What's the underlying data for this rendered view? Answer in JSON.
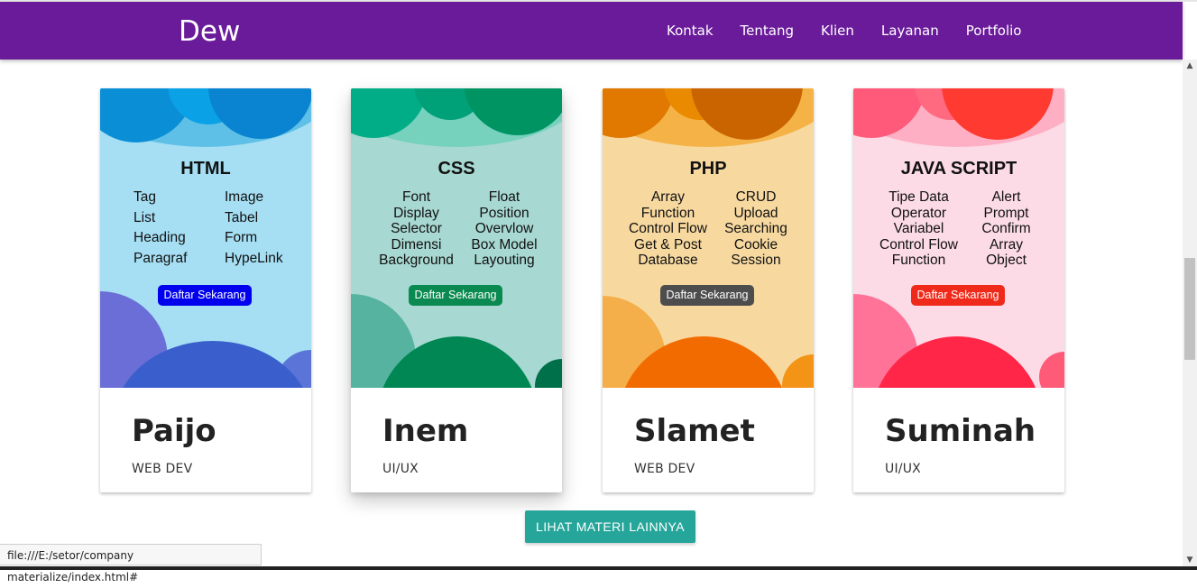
{
  "navbar": {
    "brand": "Dew",
    "links": [
      "Kontak",
      "Tentang",
      "Klien",
      "Layanan",
      "Portfolio"
    ],
    "color": "#6a1b9a"
  },
  "cards": [
    {
      "title": "HTML",
      "left_items": [
        "Tag",
        "List",
        "Heading",
        "Paragraf"
      ],
      "right_items": [
        "Image",
        "Tabel",
        "Form",
        "HypeLink"
      ],
      "button": "Daftar Sekarang",
      "name": "Paijo",
      "role": "WEB DEV",
      "colors": {
        "bg": "#a6dff4",
        "accent": "#0288d1",
        "button": "#0000ee"
      }
    },
    {
      "title": "CSS",
      "left_items": [
        "Font",
        "Display",
        "Selector",
        "Dimensi",
        "Background"
      ],
      "right_items": [
        "Float",
        "Position",
        "Overvlow",
        "Box Model",
        "Layouting"
      ],
      "button": "Daftar Sekarang",
      "name": "Inem",
      "role": "UI/UX",
      "colors": {
        "bg": "#a8d8d2",
        "accent": "#00875a",
        "button": "#0a8a50"
      }
    },
    {
      "title": "PHP",
      "left_items": [
        "Array",
        "Function",
        "Control Flow",
        "Get & Post",
        "Database"
      ],
      "right_items": [
        "CRUD",
        "Upload",
        "Searching",
        "Cookie",
        "Session"
      ],
      "button": "Daftar Sekarang",
      "name": "Slamet",
      "role": "WEB DEV",
      "colors": {
        "bg": "#f7d9a0",
        "accent": "#f57c00",
        "button": "#4d4d4d"
      }
    },
    {
      "title": "JAVA SCRIPT",
      "left_items": [
        "Tipe Data",
        "Operator",
        "Variabel",
        "Control Flow",
        "Function"
      ],
      "right_items": [
        "Alert",
        "Prompt",
        "Confirm",
        "Array",
        "Object"
      ],
      "button": "Daftar Sekarang",
      "name": "Suminah",
      "role": "UI/UX",
      "colors": {
        "bg": "#fcdbe6",
        "accent": "#ff3d4a",
        "button": "#f02a1a"
      }
    }
  ],
  "more_button": "LIHAT MATERI LAINNYA",
  "status_url": "file:///E:/setor/company materialize/index.html#"
}
